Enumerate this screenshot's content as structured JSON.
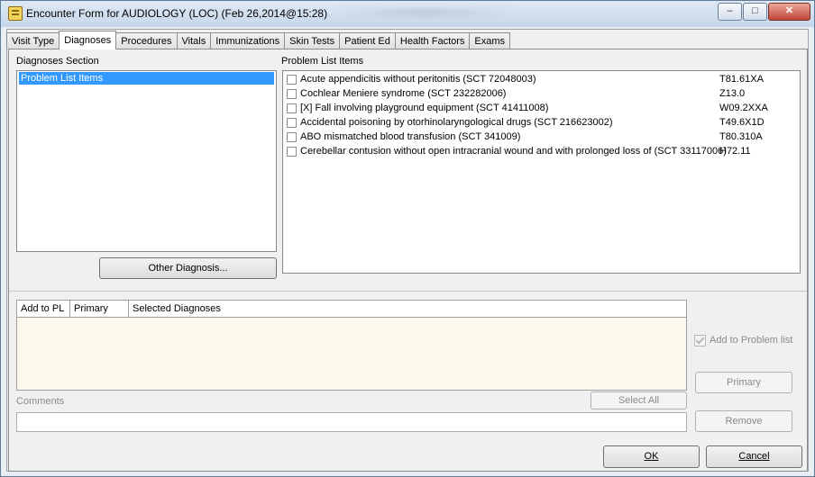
{
  "window": {
    "title": "Encounter Form for AUDIOLOGY (LOC)  (Feb 26,2014@15:28)",
    "controls": {
      "minimize": "–",
      "maximize": "□",
      "close": "✕"
    }
  },
  "tabs": [
    {
      "label": "Visit Type"
    },
    {
      "label": "Diagnoses",
      "active": true
    },
    {
      "label": "Procedures"
    },
    {
      "label": "Vitals"
    },
    {
      "label": "Immunizations"
    },
    {
      "label": "Skin Tests"
    },
    {
      "label": "Patient Ed"
    },
    {
      "label": "Health Factors"
    },
    {
      "label": "Exams"
    }
  ],
  "diagnoses_section": {
    "label": "Diagnoses Section",
    "items": [
      "Problem List Items"
    ],
    "selected_item": "Problem List Items",
    "other_button": "Other Diagnosis..."
  },
  "problem_list": {
    "label": "Problem List Items",
    "items": [
      {
        "text": "Acute appendicitis without peritonitis (SCT 72048003)",
        "code": "T81.61XA",
        "checked": false
      },
      {
        "text": "Cochlear Meniere syndrome (SCT 232282006)",
        "code": "Z13.0",
        "checked": false
      },
      {
        "text": "[X] Fall involving playground equipment (SCT 41411008)",
        "code": "W09.2XXA",
        "checked": false
      },
      {
        "text": "Accidental poisoning by otorhinolaryngological drugs (SCT 216623002)",
        "code": "T49.6X1D",
        "checked": false
      },
      {
        "text": "ABO mismatched blood transfusion (SCT 341009)",
        "code": "T80.310A",
        "checked": false
      },
      {
        "text": "Cerebellar contusion without open intracranial wound and with prolonged loss of (SCT 33117006)",
        "code": "H72.11",
        "checked": false
      }
    ]
  },
  "selected_diagnoses": {
    "columns": [
      "Add to PL",
      "Primary",
      "Selected Diagnoses"
    ],
    "rows": []
  },
  "comments": {
    "label": "Comments",
    "value": ""
  },
  "buttons": {
    "select_all": "Select All",
    "add_to_problem_list": "Add to Problem list",
    "primary": "Primary",
    "remove": "Remove",
    "ok": "OK",
    "cancel": "Cancel"
  }
}
